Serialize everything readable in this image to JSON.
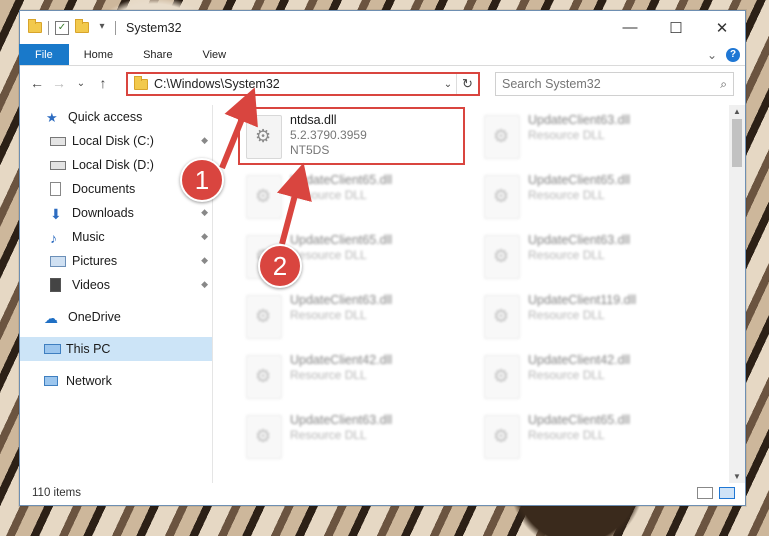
{
  "window": {
    "title": "System32",
    "controls": {
      "minimize": "—",
      "maximize": "☐",
      "close": "✕"
    }
  },
  "ribbon": {
    "tabs": [
      "File",
      "Home",
      "Share",
      "View"
    ],
    "expand": "⌄",
    "help": "?"
  },
  "address": {
    "path": "C:\\Windows\\System32",
    "dropdown": "⌄",
    "refresh": "↻"
  },
  "search": {
    "placeholder": "Search System32",
    "icon": "⌕"
  },
  "nav_buttons": {
    "back": "←",
    "forward": "→",
    "recent": "⌄",
    "up": "↑"
  },
  "sidebar": {
    "items": [
      {
        "label": "Quick access",
        "icon": "star-icon"
      },
      {
        "label": "Local Disk (C:)",
        "icon": "drive-icon",
        "pinned": true
      },
      {
        "label": "Local Disk (D:)",
        "icon": "drive-icon"
      },
      {
        "label": "Documents",
        "icon": "documents-icon",
        "pinned": true
      },
      {
        "label": "Downloads",
        "icon": "downloads-icon",
        "pinned": true
      },
      {
        "label": "Music",
        "icon": "music-icon",
        "pinned": true
      },
      {
        "label": "Pictures",
        "icon": "pictures-icon",
        "pinned": true
      },
      {
        "label": "Videos",
        "icon": "videos-icon",
        "pinned": true
      },
      {
        "label": "OneDrive",
        "icon": "onedrive-icon"
      },
      {
        "label": "This PC",
        "icon": "pc-icon",
        "selected": true
      },
      {
        "label": "Network",
        "icon": "network-icon"
      }
    ],
    "pin_glyph": "📌"
  },
  "files": [
    {
      "name": "ntdsa.dll",
      "line2": "5.2.3790.3959",
      "line3": "NT5DS",
      "highlight": true
    },
    {
      "name": "UpdateClient63.dll",
      "line2": "Resource DLL"
    },
    {
      "name": "UpdateClient65.dll",
      "line2": "Resource DLL"
    },
    {
      "name": "UpdateClient65.dll",
      "line2": "Resource DLL"
    },
    {
      "name": "UpdateClient65.dll",
      "line2": "Resource DLL"
    },
    {
      "name": "UpdateClient63.dll",
      "line2": "Resource DLL"
    },
    {
      "name": "UpdateClient63.dll",
      "line2": "Resource DLL"
    },
    {
      "name": "UpdateClient119.dll",
      "line2": "Resource DLL"
    },
    {
      "name": "UpdateClient42.dll",
      "line2": "Resource DLL"
    },
    {
      "name": "UpdateClient42.dll",
      "line2": "Resource DLL"
    },
    {
      "name": "UpdateClient63.dll",
      "line2": "Resource DLL"
    },
    {
      "name": "UpdateClient65.dll",
      "line2": "Resource DLL"
    }
  ],
  "status": {
    "count": "110 items"
  },
  "annotations": {
    "one": "1",
    "two": "2"
  },
  "colors": {
    "accent": "#1979ca",
    "highlight": "#d9453f",
    "selected": "#cce4f7"
  }
}
